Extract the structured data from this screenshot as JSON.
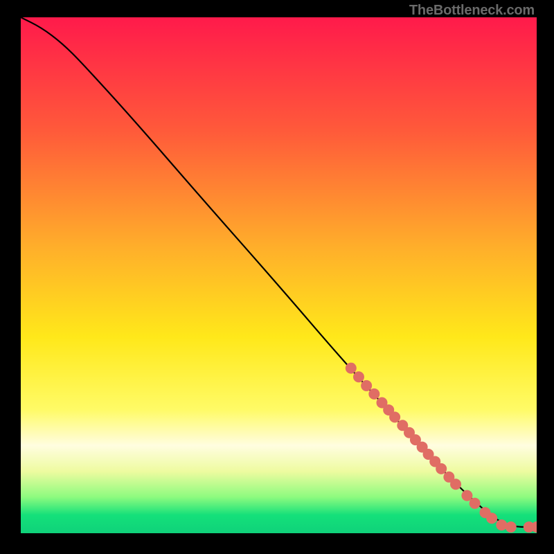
{
  "watermark": "TheBottleneck.com",
  "chart_data": {
    "type": "line",
    "title": "",
    "xlabel": "",
    "ylabel": "",
    "xlim": [
      0,
      100
    ],
    "ylim": [
      0,
      100
    ],
    "gradient_stops": [
      {
        "offset": 0,
        "color": "#ff1a4b"
      },
      {
        "offset": 22,
        "color": "#ff5a3a"
      },
      {
        "offset": 45,
        "color": "#ffb02a"
      },
      {
        "offset": 62,
        "color": "#ffe81a"
      },
      {
        "offset": 76,
        "color": "#fffb66"
      },
      {
        "offset": 83,
        "color": "#fffde0"
      },
      {
        "offset": 88,
        "color": "#eefba0"
      },
      {
        "offset": 93,
        "color": "#8dfb7f"
      },
      {
        "offset": 96.5,
        "color": "#14e07a"
      },
      {
        "offset": 100,
        "color": "#0fd27a"
      }
    ],
    "curve": [
      {
        "x": 0,
        "y": 100
      },
      {
        "x": 4,
        "y": 98
      },
      {
        "x": 8,
        "y": 95
      },
      {
        "x": 12,
        "y": 91
      },
      {
        "x": 22,
        "y": 80
      },
      {
        "x": 35,
        "y": 65
      },
      {
        "x": 50,
        "y": 48
      },
      {
        "x": 62,
        "y": 34
      },
      {
        "x": 72,
        "y": 23
      },
      {
        "x": 80,
        "y": 14
      },
      {
        "x": 88,
        "y": 6
      },
      {
        "x": 93,
        "y": 2
      },
      {
        "x": 96,
        "y": 1.2
      },
      {
        "x": 100,
        "y": 1.2
      }
    ],
    "markers": [
      {
        "x": 64,
        "y": 32
      },
      {
        "x": 65.5,
        "y": 30.3
      },
      {
        "x": 67,
        "y": 28.6
      },
      {
        "x": 68.5,
        "y": 27
      },
      {
        "x": 70,
        "y": 25.3
      },
      {
        "x": 71.3,
        "y": 23.9
      },
      {
        "x": 72.5,
        "y": 22.5
      },
      {
        "x": 74,
        "y": 20.9
      },
      {
        "x": 75.3,
        "y": 19.5
      },
      {
        "x": 76.5,
        "y": 18.1
      },
      {
        "x": 77.8,
        "y": 16.7
      },
      {
        "x": 79,
        "y": 15.3
      },
      {
        "x": 80.3,
        "y": 13.9
      },
      {
        "x": 81.5,
        "y": 12.5
      },
      {
        "x": 83,
        "y": 10.9
      },
      {
        "x": 84.3,
        "y": 9.5
      },
      {
        "x": 86.5,
        "y": 7.3
      },
      {
        "x": 88,
        "y": 5.8
      },
      {
        "x": 90,
        "y": 4
      },
      {
        "x": 91.3,
        "y": 2.9
      },
      {
        "x": 93.2,
        "y": 1.6
      },
      {
        "x": 95,
        "y": 1.2
      },
      {
        "x": 98.5,
        "y": 1.2
      },
      {
        "x": 100,
        "y": 1.2
      }
    ],
    "marker_color": "#e06d64",
    "marker_radius_px": 8
  }
}
